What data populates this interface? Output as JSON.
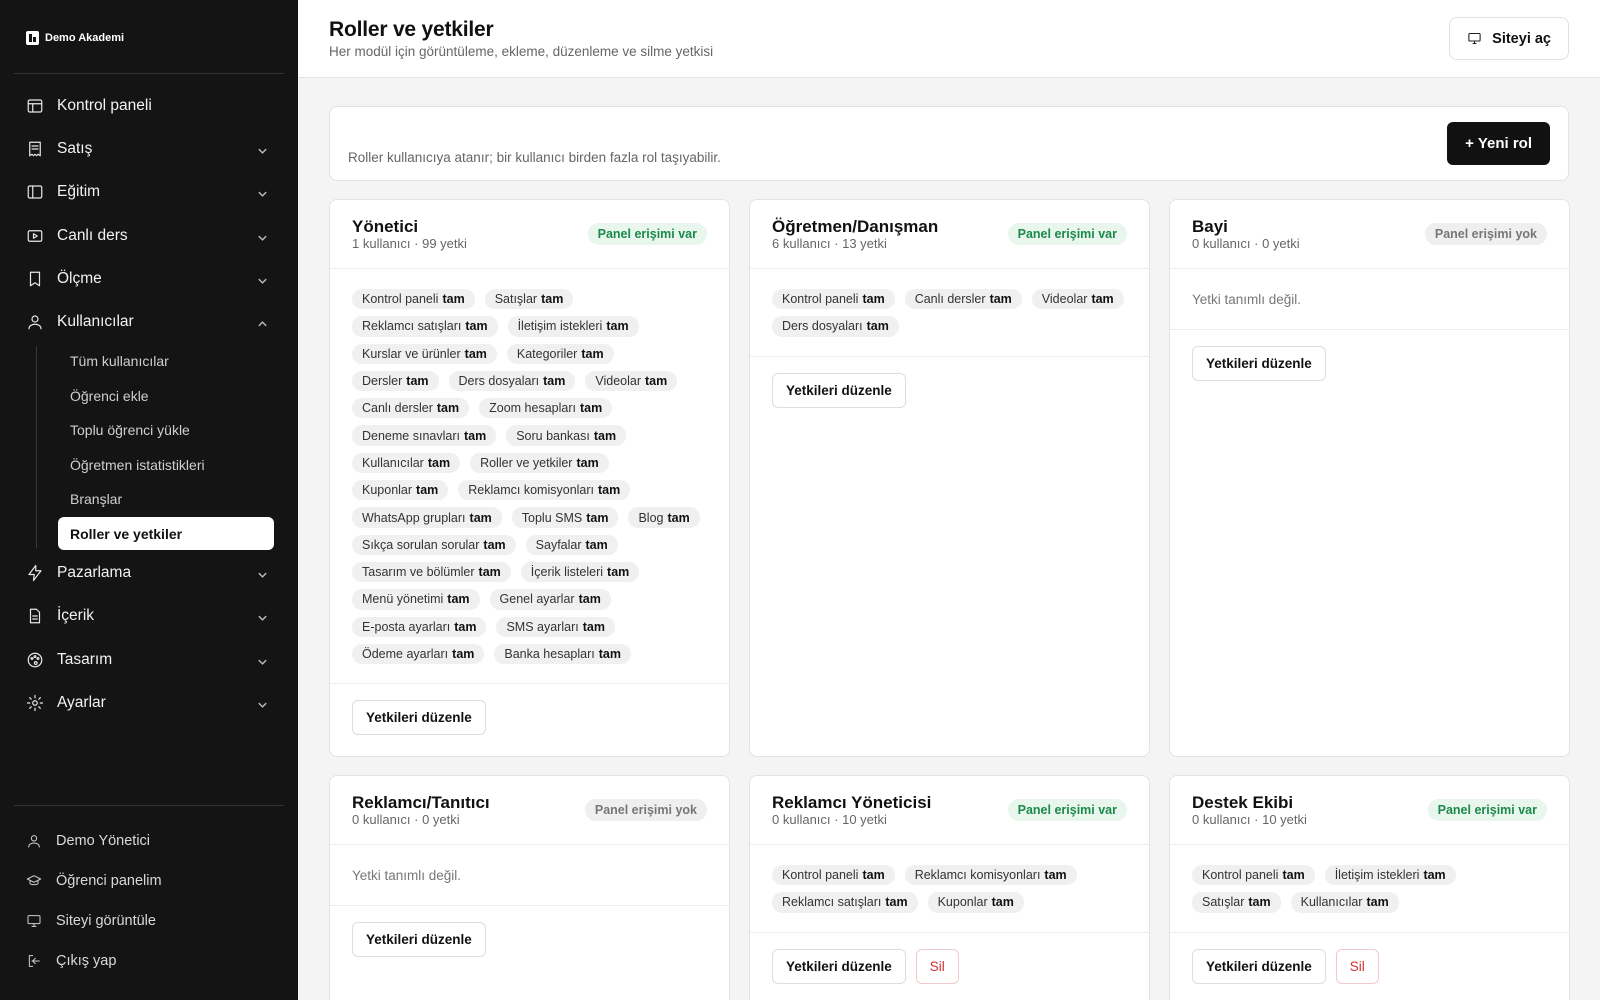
{
  "brand": {
    "name": "Demo Akademi"
  },
  "sidebar": {
    "items": [
      {
        "label": "Kontrol paneli",
        "icon": "layout-icon"
      },
      {
        "label": "Satış",
        "icon": "receipt-icon"
      },
      {
        "label": "Eğitim",
        "icon": "book-icon"
      },
      {
        "label": "Canlı ders",
        "icon": "video-icon"
      },
      {
        "label": "Ölçme",
        "icon": "bookmark-icon"
      },
      {
        "label": "Kullanıcılar",
        "icon": "user-icon"
      },
      {
        "label": "Pazarlama",
        "icon": "bolt-icon"
      },
      {
        "label": "İçerik",
        "icon": "file-icon"
      },
      {
        "label": "Tasarım",
        "icon": "palette-icon"
      },
      {
        "label": "Ayarlar",
        "icon": "gear-icon"
      }
    ],
    "sub_items": [
      "Tüm kullanıcılar",
      "Öğrenci ekle",
      "Toplu öğrenci yükle",
      "Öğretmen istatistikleri",
      "Branşlar",
      "Roller ve yetkiler"
    ],
    "footer": [
      {
        "label": "Demo Yönetici",
        "icon": "user-icon"
      },
      {
        "label": "Öğrenci panelim",
        "icon": "graduation-cap-icon"
      },
      {
        "label": "Siteyi görüntüle",
        "icon": "monitor-icon"
      },
      {
        "label": "Çıkış yap",
        "icon": "logout-icon"
      }
    ]
  },
  "header": {
    "title": "Roller ve yetkiler",
    "subtitle": "Her modül için görüntüleme, ekleme, düzenleme ve silme yetkisi",
    "site_button": "Siteyi aç"
  },
  "info": {
    "text": "Roller kullanıcıya atanır; bir kullanıcı birden fazla rol taşıyabilir.",
    "new_role_button": "+ Yeni rol"
  },
  "labels": {
    "perm_level": "tam",
    "edit_button": "Yetkileri düzenle",
    "delete_button": "Sil",
    "empty_text": "Yetki tanımlı değil."
  },
  "roles": [
    {
      "name": "Yönetici",
      "meta": "1 kullanıcı · 99 yetki",
      "badge": "Panel erişimi var",
      "access": true,
      "perms": [
        "Kontrol paneli",
        "Satışlar",
        "Reklamcı satışları",
        "İletişim istekleri",
        "Kurslar ve ürünler",
        "Kategoriler",
        "Dersler",
        "Ders dosyaları",
        "Videolar",
        "Canlı dersler",
        "Zoom hesapları",
        "Deneme sınavları",
        "Soru bankası",
        "Kullanıcılar",
        "Roller ve yetkiler",
        "Kuponlar",
        "Reklamcı komisyonları",
        "WhatsApp grupları",
        "Toplu SMS",
        "Blog",
        "Sıkça sorulan sorular",
        "Sayfalar",
        "Tasarım ve bölümler",
        "İçerik listeleri",
        "Menü yönetimi",
        "Genel ayarlar",
        "E-posta ayarları",
        "SMS ayarları",
        "Ödeme ayarları",
        "Banka hesapları"
      ],
      "deletable": false
    },
    {
      "name": "Öğretmen/Danışman",
      "meta": "6 kullanıcı · 13 yetki",
      "badge": "Panel erişimi var",
      "access": true,
      "perms": [
        "Kontrol paneli",
        "Canlı dersler",
        "Videolar",
        "Ders dosyaları"
      ],
      "deletable": false
    },
    {
      "name": "Bayi",
      "meta": "0 kullanıcı · 0 yetki",
      "badge": "Panel erişimi yok",
      "access": false,
      "perms": [],
      "deletable": false
    },
    {
      "name": "Reklamcı/Tanıtıcı",
      "meta": "0 kullanıcı · 0 yetki",
      "badge": "Panel erişimi yok",
      "access": false,
      "perms": [],
      "deletable": false
    },
    {
      "name": "Reklamcı Yöneticisi",
      "meta": "0 kullanıcı · 10 yetki",
      "badge": "Panel erişimi var",
      "access": true,
      "perms": [
        "Kontrol paneli",
        "Reklamcı komisyonları",
        "Reklamcı satışları",
        "Kuponlar"
      ],
      "deletable": true
    },
    {
      "name": "Destek Ekibi",
      "meta": "0 kullanıcı · 10 yetki",
      "badge": "Panel erişimi var",
      "access": true,
      "perms": [
        "Kontrol paneli",
        "İletişim istekleri",
        "Satışlar",
        "Kullanıcılar"
      ],
      "deletable": true
    }
  ]
}
